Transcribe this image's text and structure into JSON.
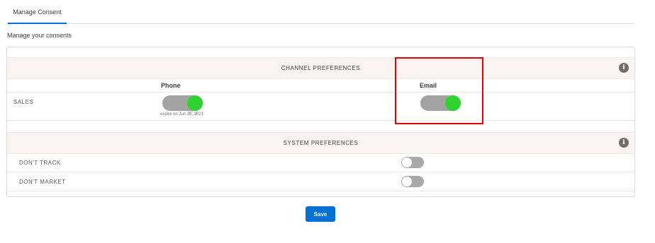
{
  "tabs": [
    {
      "label": "Manage Consent",
      "active": true
    }
  ],
  "subtitle": "Manage your consents",
  "channel_preferences": {
    "title": "CHANNEL PREFERENCES",
    "columns": [
      "Phone",
      "Email"
    ],
    "rows": [
      {
        "label": "SALES",
        "phone": {
          "on": true,
          "note": "expire on Jun 26, 2021"
        },
        "email": {
          "on": true
        }
      }
    ]
  },
  "system_preferences": {
    "title": "SYSTEM PREFERENCES",
    "rows": [
      {
        "label": "DON'T TRACK",
        "on": false
      },
      {
        "label": "DON'T MARKET",
        "on": false
      }
    ]
  },
  "info_icon_glyph": "i",
  "save_label": "Save",
  "colors": {
    "accent": "#0070d2",
    "toggle_on": "#2fd22f",
    "highlight": "#e00000"
  }
}
